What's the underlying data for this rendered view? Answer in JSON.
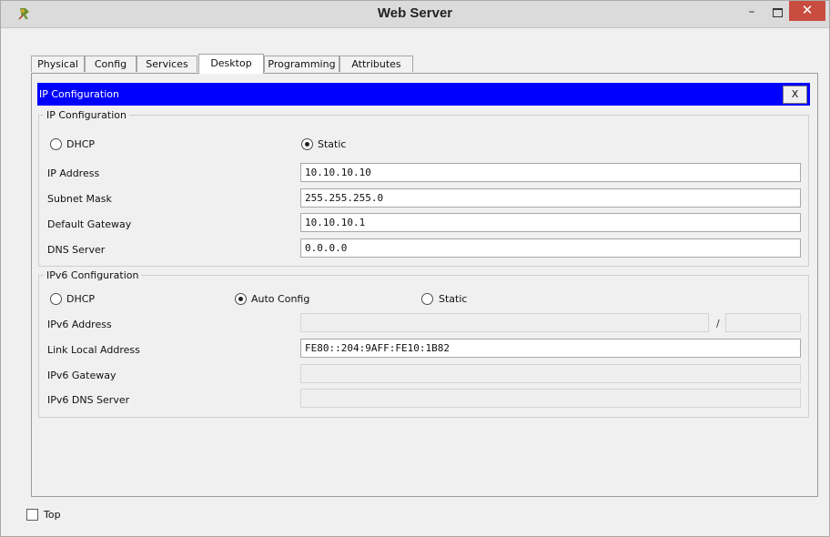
{
  "window": {
    "title": "Web Server"
  },
  "titlebar": {
    "minimize_glyph": "–",
    "close_glyph": "✕"
  },
  "tabs": [
    {
      "label": "Physical"
    },
    {
      "label": "Config"
    },
    {
      "label": "Services"
    },
    {
      "label": "Desktop",
      "active": true
    },
    {
      "label": "Programming"
    },
    {
      "label": "Attributes"
    }
  ],
  "ip_config": {
    "header": "IP Configuration",
    "close_label": "X",
    "ipv4": {
      "legend": "IP Configuration",
      "dhcp_label": "DHCP",
      "static_label": "Static",
      "mode": "static",
      "ip_address_label": "IP Address",
      "ip_address": "10.10.10.10",
      "subnet_mask_label": "Subnet Mask",
      "subnet_mask": "255.255.255.0",
      "gateway_label": "Default Gateway",
      "gateway": "10.10.10.1",
      "dns_label": "DNS Server",
      "dns": "0.0.0.0"
    },
    "ipv6": {
      "legend": "IPv6 Configuration",
      "dhcp_label": "DHCP",
      "auto_label": "Auto Config",
      "static_label": "Static",
      "mode": "auto",
      "address_label": "IPv6 Address",
      "address": "",
      "prefix_separator": "/",
      "prefix": "",
      "link_local_label": "Link Local Address",
      "link_local": "FE80::204:9AFF:FE10:1B82",
      "gateway_label": "IPv6 Gateway",
      "gateway": "",
      "dns_label": "IPv6 DNS Server",
      "dns": ""
    }
  },
  "footer": {
    "top_label": "Top",
    "top_checked": false
  },
  "colors": {
    "header_blue": "#0000ff",
    "close_red": "#c94c41"
  }
}
